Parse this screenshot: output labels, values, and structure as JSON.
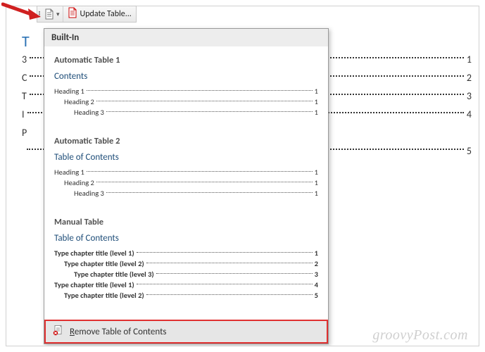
{
  "toolbar": {
    "update_label": "Update Table..."
  },
  "dropdown": {
    "header": "Built-In",
    "auto1": {
      "title": "Automatic Table 1",
      "heading": "Contents",
      "rows": [
        {
          "label": "Heading 1",
          "page": "1",
          "indent": 0
        },
        {
          "label": "Heading 2",
          "page": "1",
          "indent": 1
        },
        {
          "label": "Heading 3",
          "page": "1",
          "indent": 2
        }
      ]
    },
    "auto2": {
      "title": "Automatic Table 2",
      "heading": "Table of Contents",
      "rows": [
        {
          "label": "Heading 1",
          "page": "1",
          "indent": 0
        },
        {
          "label": "Heading 2",
          "page": "1",
          "indent": 1
        },
        {
          "label": "Heading 3",
          "page": "1",
          "indent": 2
        }
      ]
    },
    "manual": {
      "title": "Manual Table",
      "heading": "Table of Contents",
      "rows": [
        {
          "label": "Type chapter title (level 1)",
          "page": "1",
          "indent": 0
        },
        {
          "label": "Type chapter title (level 2)",
          "page": "2",
          "indent": 1
        },
        {
          "label": "Type chapter title (level 3)",
          "page": "3",
          "indent": 2
        },
        {
          "label": "Type chapter title (level 1)",
          "page": "4",
          "indent": 0
        },
        {
          "label": "Type chapter title (level 2)",
          "page": "5",
          "indent": 1
        }
      ]
    },
    "remove_prefix": "R",
    "remove_rest": "emove Table of Contents"
  },
  "background": {
    "left_chars": [
      "T",
      "3",
      "C",
      "T",
      "I",
      "P"
    ],
    "right_pages": [
      "1",
      "2",
      "3",
      "4",
      "5"
    ]
  },
  "watermark": "groovyPost.com"
}
